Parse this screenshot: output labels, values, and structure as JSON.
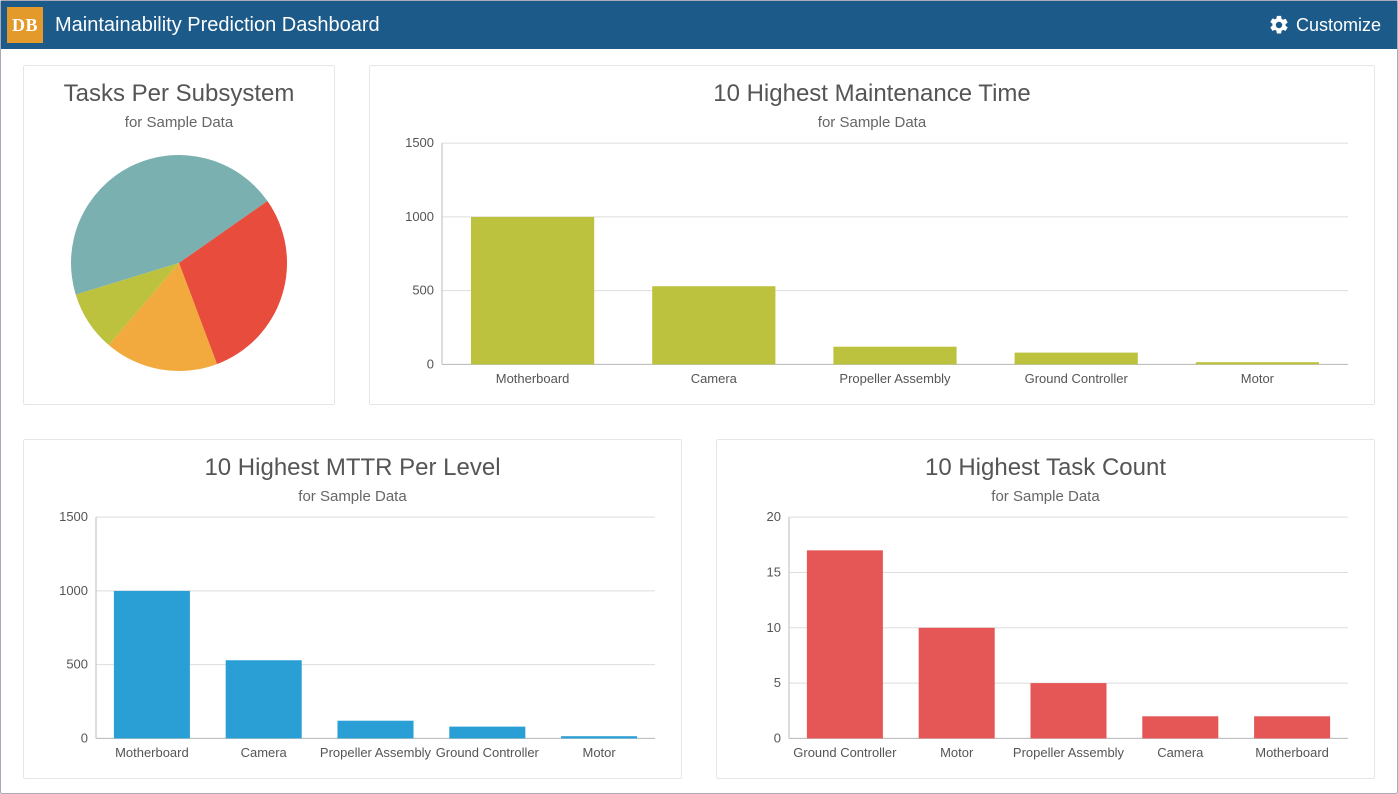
{
  "header": {
    "logo_text": "DB",
    "title": "Maintainability Prediction Dashboard",
    "customize_label": "Customize"
  },
  "subtitle_text": "for Sample Data",
  "pie_card": {
    "title": "Tasks Per Subsystem"
  },
  "bar1_card": {
    "title": "10 Highest Maintenance Time"
  },
  "bar2_card": {
    "title": "10 Highest MTTR Per Level"
  },
  "bar3_card": {
    "title": "10 Highest Task Count"
  },
  "colors": {
    "pie_slices": [
      "#7bb0b0",
      "#e74c3c",
      "#f2a93e",
      "#bcc23d"
    ],
    "bar_olive": "#bcc23d",
    "bar_blue": "#2a9fd6",
    "bar_red": "#e55757"
  },
  "chart_data": [
    {
      "id": "pie",
      "type": "pie",
      "title": "Tasks Per Subsystem",
      "subtitle": "for Sample Data",
      "slices": [
        {
          "label": "Teal slice",
          "value": 45
        },
        {
          "label": "Red slice",
          "value": 29
        },
        {
          "label": "Orange slice",
          "value": 17
        },
        {
          "label": "Olive slice",
          "value": 9
        }
      ]
    },
    {
      "id": "bar_maint_time",
      "type": "bar",
      "title": "10 Highest Maintenance Time",
      "subtitle": "for Sample Data",
      "ylim": [
        0,
        1500
      ],
      "yticks": [
        0,
        500,
        1000,
        1500
      ],
      "categories": [
        "Motherboard",
        "Camera",
        "Propeller Assembly",
        "Ground Controller",
        "Motor"
      ],
      "values": [
        1000,
        530,
        120,
        80,
        15
      ],
      "color": "#bcc23d"
    },
    {
      "id": "bar_mttr",
      "type": "bar",
      "title": "10 Highest MTTR Per Level",
      "subtitle": "for Sample Data",
      "ylim": [
        0,
        1500
      ],
      "yticks": [
        0,
        500,
        1000,
        1500
      ],
      "categories": [
        "Motherboard",
        "Camera",
        "Propeller Assembly",
        "Ground Controller",
        "Motor"
      ],
      "values": [
        1000,
        530,
        120,
        80,
        15
      ],
      "color": "#2a9fd6"
    },
    {
      "id": "bar_task_count",
      "type": "bar",
      "title": "10 Highest Task Count",
      "subtitle": "for Sample Data",
      "ylim": [
        0,
        20
      ],
      "yticks": [
        0,
        5,
        10,
        15,
        20
      ],
      "categories": [
        "Ground Controller",
        "Motor",
        "Propeller Assembly",
        "Camera",
        "Motherboard"
      ],
      "values": [
        17,
        10,
        5,
        2,
        2
      ],
      "color": "#e55757"
    }
  ]
}
